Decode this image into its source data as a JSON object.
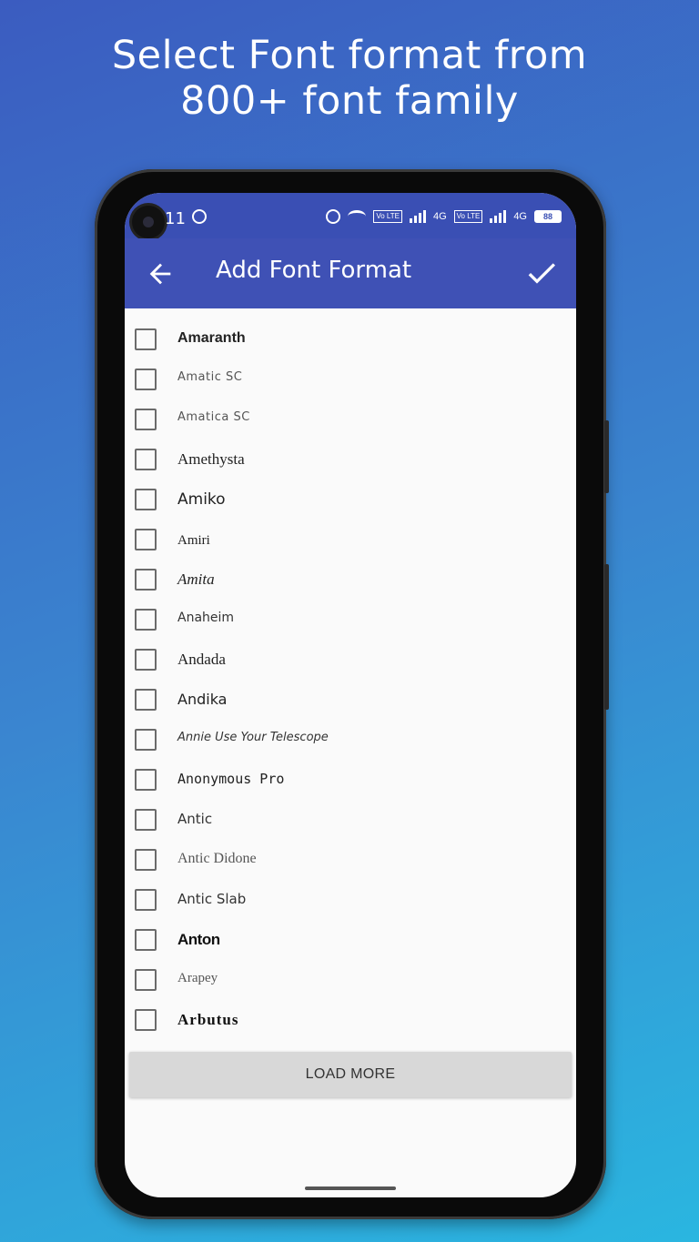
{
  "headline": {
    "line1": "Select Font format from",
    "line2": "800+ font family"
  },
  "status_bar": {
    "time": "11",
    "network_label_1": "4G",
    "network_label_2": "4G",
    "volte_label": "Vo LTE",
    "battery": "88"
  },
  "app_bar": {
    "title": "Add Font Format",
    "back_icon": "arrow-back-icon",
    "confirm_icon": "check-icon"
  },
  "fonts": [
    {
      "name": "Amaranth",
      "checked": false
    },
    {
      "name": "Amatic SC",
      "checked": false
    },
    {
      "name": "Amatica SC",
      "checked": false
    },
    {
      "name": "Amethysta",
      "checked": false
    },
    {
      "name": "Amiko",
      "checked": false
    },
    {
      "name": "Amiri",
      "checked": false
    },
    {
      "name": "Amita",
      "checked": false
    },
    {
      "name": "Anaheim",
      "checked": false
    },
    {
      "name": "Andada",
      "checked": false
    },
    {
      "name": "Andika",
      "checked": false
    },
    {
      "name": "Annie Use Your Telescope",
      "checked": false
    },
    {
      "name": "Anonymous Pro",
      "checked": false
    },
    {
      "name": "Antic",
      "checked": false
    },
    {
      "name": "Antic Didone",
      "checked": false
    },
    {
      "name": "Antic Slab",
      "checked": false
    },
    {
      "name": "Anton",
      "checked": false
    },
    {
      "name": "Arapey",
      "checked": false
    },
    {
      "name": "Arbutus",
      "checked": false
    }
  ],
  "load_more_label": "LOAD MORE",
  "colors": {
    "app_bar": "#3f51b5",
    "status_bar": "#3a4fb4",
    "background_top": "#3b5cc0",
    "background_bottom": "#2ab6e0"
  }
}
